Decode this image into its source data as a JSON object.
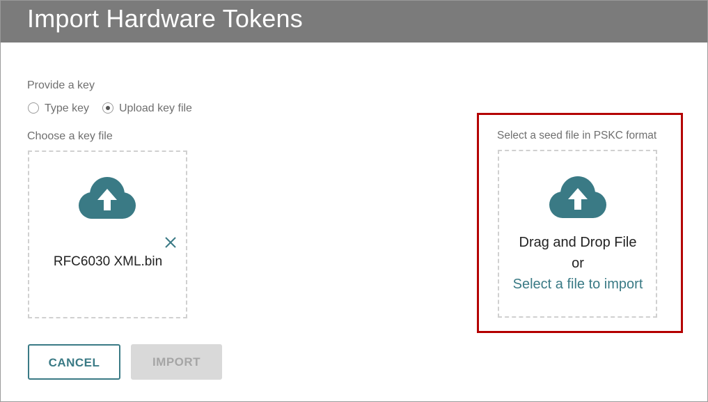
{
  "dialog": {
    "title": "Import Hardware Tokens"
  },
  "key_section": {
    "label": "Provide a key",
    "options": [
      {
        "label": "Type key",
        "selected": false
      },
      {
        "label": "Upload key file",
        "selected": true
      }
    ]
  },
  "key_file": {
    "label": "Choose a key file",
    "filename": "RFC6030 XML.bin",
    "upload_icon": "cloud-upload-icon",
    "remove_icon": "close-icon"
  },
  "seed_file": {
    "label": "Select a seed file in PSKC format",
    "drag_text": "Drag and Drop File",
    "or_text": "or",
    "select_link": "Select a file to import",
    "upload_icon": "cloud-upload-icon",
    "highlight_color": "#b40000"
  },
  "actions": {
    "cancel_label": "CANCEL",
    "import_label": "IMPORT"
  },
  "colors": {
    "title_bar": "#7b7b7b",
    "accent": "#3a7a85",
    "disabled_bg": "#d9d9d9",
    "disabled_text": "#a5a5a5"
  }
}
